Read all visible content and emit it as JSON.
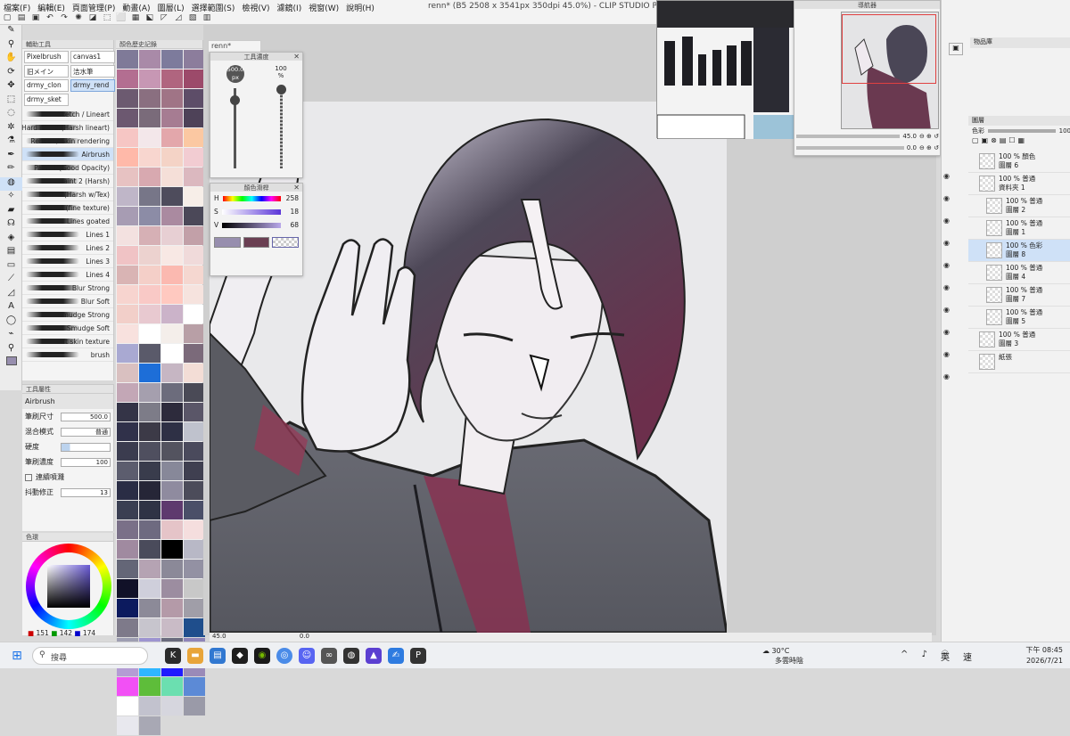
{
  "menu": [
    "檔案(F)",
    "編輯(E)",
    "頁面管理(P)",
    "動畫(A)",
    "圖層(L)",
    "選擇範圍(S)",
    "檢視(V)",
    "濾鏡(I)",
    "視窗(W)",
    "說明(H)"
  ],
  "window_title": "renn* (B5 2508 x 3541px 350dpi 45.0%) - CLIP STUDIO PAINT EX",
  "subtool": {
    "header": "輔助工具",
    "tabs": [
      "Pixelbrush",
      "canvas1",
      "旧メイン",
      "洁水筆",
      "drmy_clon",
      "drmy_rend",
      "drmy_sket"
    ],
    "brushes": [
      "Sketch / Lineart",
      "Hard round (Harsh lineart)",
      "Render / Skin rendering",
      "Airbrush",
      "Paint 1 (Good Opacity)",
      "Paint 2 (Harsh)",
      "Paint 3 (Harsh w/Tex)",
      "Paint 4 (fine texture)",
      "Lines goated",
      "Lines 1",
      "Lines 2",
      "Lines 3",
      "Lines 4",
      "Blur Strong",
      "Blur Soft",
      "Smudge Strong",
      "Smudge Soft",
      "soft skin texture",
      "brush"
    ]
  },
  "tool_property": {
    "header": "工具屬性",
    "tool_name": "Airbrush",
    "brush_size_label": "筆刷尺寸",
    "brush_size": "500.0",
    "blend_label": "混合模式",
    "blend_value": "普通",
    "hardness_label": "硬度",
    "density_label": "筆刷濃度",
    "density": "100",
    "continuous_label": "連續噴濺",
    "stabilize_label": "抖動修正",
    "stabilize": "13"
  },
  "color_wheel": {
    "header": "色環",
    "r": "151",
    "g": "142",
    "b": "174"
  },
  "swatch_header": "顏色歷史記錄",
  "swatches": [
    "#7f7a98",
    "#a98aa8",
    "#7d7b9c",
    "#8c7d9c",
    "#b36e91",
    "#c797b4",
    "#b0657f",
    "#9c4a6a",
    "#6c5a70",
    "#8a6f80",
    "#a07486",
    "#5d4d68",
    "#6c5870",
    "#7a6b7a",
    "#a67c92",
    "#4e4258",
    "#f6c6c4",
    "#f3e7ea",
    "#e3a7ab",
    "#fbc8a2",
    "#ffb9a9",
    "#f8d6cf",
    "#f4d3c6",
    "#f2ccd2",
    "#e7c2c2",
    "#d8a9b0",
    "#f5dfd8",
    "#dbb8bf",
    "#bfb6c8",
    "#777688",
    "#4e4c5c",
    "#f7eee8",
    "#a79cb3",
    "#8c8ca6",
    "#aa8aa0",
    "#4b4858",
    "#f3e1e0",
    "#d6b0b5",
    "#e7cfd3",
    "#c2a0a8",
    "#f0c3c5",
    "#ecd2cf",
    "#f8e8e4",
    "#f0dada",
    "#d9b4b4",
    "#f4cfc8",
    "#fbb9b0",
    "#f5d7d0",
    "#f7d4cf",
    "#f9c9c6",
    "#ffc9c0",
    "#f6e3de",
    "#f2cfc9",
    "#e8c9d0",
    "#cbb3c9",
    "#ffffff",
    "#f8e1de",
    "#ffffff",
    "#f4eeea",
    "#b89fa6",
    "#a9a9d2",
    "#5a5a6a",
    "#ffffff",
    "#7b6a7a",
    "#d9c0c0",
    "#1d6ed8",
    "#c6b6c3",
    "#f3ddd6",
    "#c3a7b6",
    "#a59fae",
    "#6c6c7c",
    "#4a4a56",
    "#343447",
    "#7d7c88",
    "#2d2b3c",
    "#5a5668",
    "#30314a",
    "#3c3a47",
    "#2e3045",
    "#bfc2cd",
    "#3b3c4f",
    "#4f4f5f",
    "#53535f",
    "#4a4a5c",
    "#5c5d6e",
    "#393c4c",
    "#878899",
    "#3f3f50",
    "#2a2d45",
    "#262637",
    "#8f8b9f",
    "#4c4c5a",
    "#3a3f52",
    "#2f3345",
    "#5e3a6e",
    "#4a4f68",
    "#7a7088",
    "#6e6a80",
    "#e5c4c8",
    "#f5dede",
    "#a08aa0",
    "#4a4b5b",
    "#000000",
    "#b8b8c6",
    "#646677",
    "#b5a3b3",
    "#8b8998",
    "#9391a3",
    "#111128",
    "#cfcfdb",
    "#9c8da0",
    "#c8c8c8",
    "#0c1a5e",
    "#8c8a98",
    "#b49aa8",
    "#a09ea8",
    "#7e7a8a",
    "#c7c5cd",
    "#c9bbc6",
    "#1f4e8c",
    "#9e9eb2",
    "#9d94d0",
    "#6a6b7d",
    "#8e84b9",
    "#b49cd4",
    "#2fb6ff",
    "#1f1bff",
    "#9a8ab8",
    "#f250f5",
    "#5ebd3a",
    "#6bdfb0",
    "#5c8ad6",
    "#ffffff",
    "#c2c2ce",
    "#d6d6de",
    "#9a9aa8",
    "#e8e8ee",
    "#a8a8b4"
  ],
  "canvas_tab": "renn*",
  "brush_size_panel": {
    "header": "工具濃度",
    "size": "500.0",
    "size_unit": "px",
    "density": "100",
    "density_unit": "%"
  },
  "color_slider": {
    "header": "顏色滑桿",
    "h": "258",
    "s": "18",
    "v": "68"
  },
  "status": {
    "zoom": "45.0",
    "zoom2": "0.0"
  },
  "navigator": {
    "header": "導航器",
    "zoom": "45.0",
    "angle": "0.0"
  },
  "layer_panel": {
    "header": "圖層",
    "blend": "色彩",
    "opacity": "100"
  },
  "layers": [
    {
      "pct": "100 %",
      "mode": "顏色",
      "name": "圖層 6",
      "sel": false,
      "indent": 0
    },
    {
      "pct": "100 %",
      "mode": "普通",
      "name": "資料夾 1",
      "sel": false,
      "indent": 0
    },
    {
      "pct": "100 %",
      "mode": "普通",
      "name": "圖層 2",
      "sel": false,
      "indent": 1
    },
    {
      "pct": "100 %",
      "mode": "普通",
      "name": "圖層 1",
      "sel": false,
      "indent": 1
    },
    {
      "pct": "100 %",
      "mode": "色彩",
      "name": "圖層 8",
      "sel": true,
      "indent": 1
    },
    {
      "pct": "100 %",
      "mode": "普通",
      "name": "圖層 4",
      "sel": false,
      "indent": 1
    },
    {
      "pct": "100 %",
      "mode": "普通",
      "name": "圖層 7",
      "sel": false,
      "indent": 1
    },
    {
      "pct": "100 %",
      "mode": "普通",
      "name": "圖層 5",
      "sel": false,
      "indent": 1
    },
    {
      "pct": "100 %",
      "mode": "普通",
      "name": "圖層 3",
      "sel": false,
      "indent": 0
    },
    {
      "pct": "",
      "mode": "",
      "name": "紙張",
      "sel": false,
      "indent": 0
    }
  ],
  "object_panel": "物品庫",
  "taskbar": {
    "search": "搜尋",
    "weather_temp": "30°C",
    "weather_desc": "多雲時陰",
    "lang1": "英",
    "lang2": "速",
    "time": "下午 08:45",
    "date": "2026/7/21"
  }
}
